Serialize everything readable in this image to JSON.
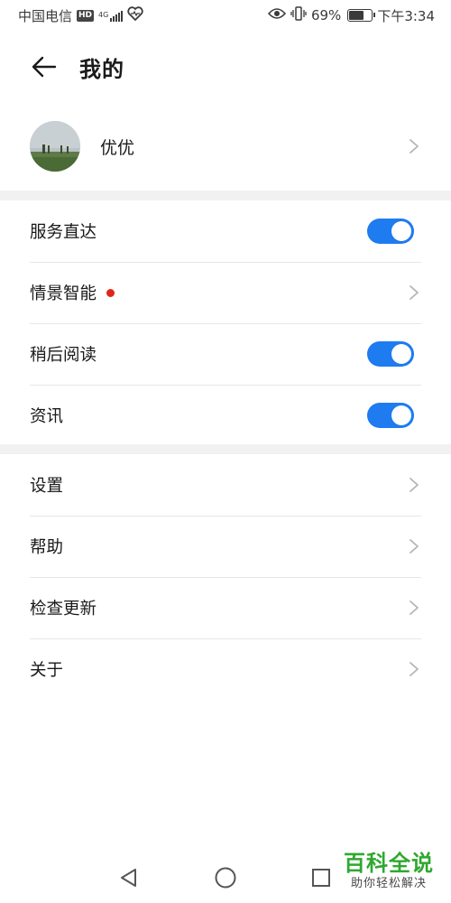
{
  "status_bar": {
    "carrier": "中国电信",
    "hd": "HD",
    "network": "4G",
    "battery": "69%",
    "battery_level": 0.69,
    "time": "下午3:34"
  },
  "header": {
    "title": "我的"
  },
  "profile": {
    "name": "优优"
  },
  "section1": {
    "items": [
      {
        "label": "服务直达",
        "control": "toggle",
        "on": true
      },
      {
        "label": "情景智能",
        "control": "chevron",
        "badge_dot": true
      },
      {
        "label": "稍后阅读",
        "control": "toggle",
        "on": true
      },
      {
        "label": "资讯",
        "control": "toggle",
        "on": true
      }
    ]
  },
  "section2": {
    "items": [
      {
        "label": "设置",
        "control": "chevron"
      },
      {
        "label": "帮助",
        "control": "chevron"
      },
      {
        "label": "检查更新",
        "control": "chevron"
      },
      {
        "label": "关于",
        "control": "chevron"
      }
    ]
  },
  "watermark": {
    "title": "百科全说",
    "subtitle": "助你轻松解决"
  },
  "colors": {
    "toggle_on": "#1e7bf0",
    "badge_dot": "#e0261a",
    "divider": "#f1f1f1",
    "watermark": "#2fa82f"
  }
}
